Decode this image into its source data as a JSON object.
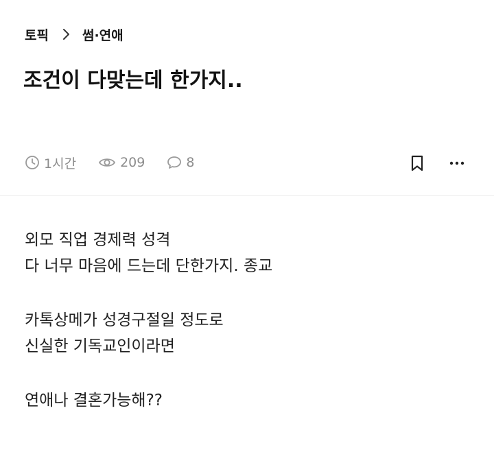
{
  "breadcrumb": {
    "root": "토픽",
    "separator_icon": "chevron-right-icon",
    "category": "썸·연애"
  },
  "post": {
    "title": "조건이 다맞는데 한가지..",
    "meta": {
      "time": "1시간",
      "views": "209",
      "comments": "8"
    },
    "body": {
      "p1": [
        "외모 직업 경제력 성격",
        "다 너무 마음에 드는데 단한가지. 종교"
      ],
      "p2": [
        "카톡상메가 성경구절일 정도로",
        "신실한 기독교인이라면"
      ],
      "p3": [
        "연애나 결혼가능해??"
      ]
    }
  },
  "icons": {
    "time": "clock-icon",
    "views": "eye-icon",
    "comments": "comment-icon",
    "bookmark": "bookmark-icon",
    "more": "more-icon"
  },
  "colors": {
    "text": "#111111",
    "meta": "#8c8c8c",
    "divider": "#ececec"
  }
}
